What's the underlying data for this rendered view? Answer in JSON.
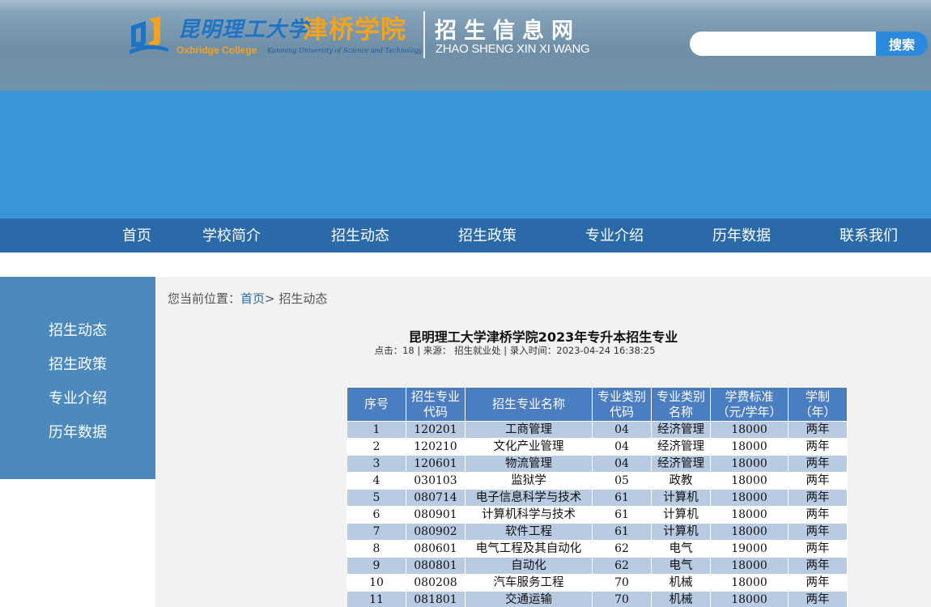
{
  "header": {
    "logo_cn_school": "昆明理工大学",
    "logo_cn_college": "津桥学院",
    "logo_en_college": "Oxbridge College",
    "logo_en_university": "Kunming University of Science and Technology",
    "site_title": "招生信息网",
    "site_pinyin": "ZHAO SHENG XIN XI WANG",
    "search_placeholder": "",
    "search_button": "搜索",
    "colors": {
      "logo_blue": "#1f73c4",
      "logo_orange": "#f6a31c",
      "search_button": "#2b8ae0"
    }
  },
  "nav": {
    "items": [
      {
        "label": "首页"
      },
      {
        "label": "学校简介"
      },
      {
        "label": "招生动态"
      },
      {
        "label": "招生政策"
      },
      {
        "label": "专业介绍"
      },
      {
        "label": "历年数据"
      },
      {
        "label": "联系我们"
      }
    ],
    "color": "#2b6aa8"
  },
  "sidebar": {
    "items": [
      {
        "label": "招生动态"
      },
      {
        "label": "招生政策"
      },
      {
        "label": "专业介绍"
      },
      {
        "label": "历年数据"
      }
    ],
    "color": "#4c89bd"
  },
  "breadcrumb": {
    "prefix": "您当前位置：",
    "home": "首页",
    "separator": ">",
    "current": "招生动态"
  },
  "article": {
    "title": "昆明理工大学津桥学院2023年专升本招生专业",
    "meta": "点击：18 | 来源： 招生就业处 | 录入时间：2023-04-24 16:38:25"
  },
  "table": {
    "header_color": "#4a7ec1",
    "stripe_color": "#b8cbe2",
    "headers": [
      {
        "line1": "序号",
        "line2": ""
      },
      {
        "line1": "招生专业",
        "line2": "代码"
      },
      {
        "line1": "招生专业名称",
        "line2": ""
      },
      {
        "line1": "专业类别",
        "line2": "代码"
      },
      {
        "line1": "专业类别",
        "line2": "名称"
      },
      {
        "line1": "学费标准",
        "line2": "（元/学年）"
      },
      {
        "line1": "学制",
        "line2": "（年）"
      }
    ],
    "rows": [
      [
        "1",
        "120201",
        "工商管理",
        "04",
        "经济管理",
        "18000",
        "两年"
      ],
      [
        "2",
        "120210",
        "文化产业管理",
        "04",
        "经济管理",
        "18000",
        "两年"
      ],
      [
        "3",
        "120601",
        "物流管理",
        "04",
        "经济管理",
        "18000",
        "两年"
      ],
      [
        "4",
        "030103",
        "监狱学",
        "05",
        "政教",
        "18000",
        "两年"
      ],
      [
        "5",
        "080714",
        "电子信息科学与技术",
        "61",
        "计算机",
        "18000",
        "两年"
      ],
      [
        "6",
        "080901",
        "计算机科学与技术",
        "61",
        "计算机",
        "18000",
        "两年"
      ],
      [
        "7",
        "080902",
        "软件工程",
        "61",
        "计算机",
        "18000",
        "两年"
      ],
      [
        "8",
        "080601",
        "电气工程及其自动化",
        "62",
        "电气",
        "19000",
        "两年"
      ],
      [
        "9",
        "080801",
        "自动化",
        "62",
        "电气",
        "18000",
        "两年"
      ],
      [
        "10",
        "080208",
        "汽车服务工程",
        "70",
        "机械",
        "18000",
        "两年"
      ],
      [
        "11",
        "081801",
        "交通运输",
        "70",
        "机械",
        "18000",
        "两年"
      ]
    ]
  }
}
